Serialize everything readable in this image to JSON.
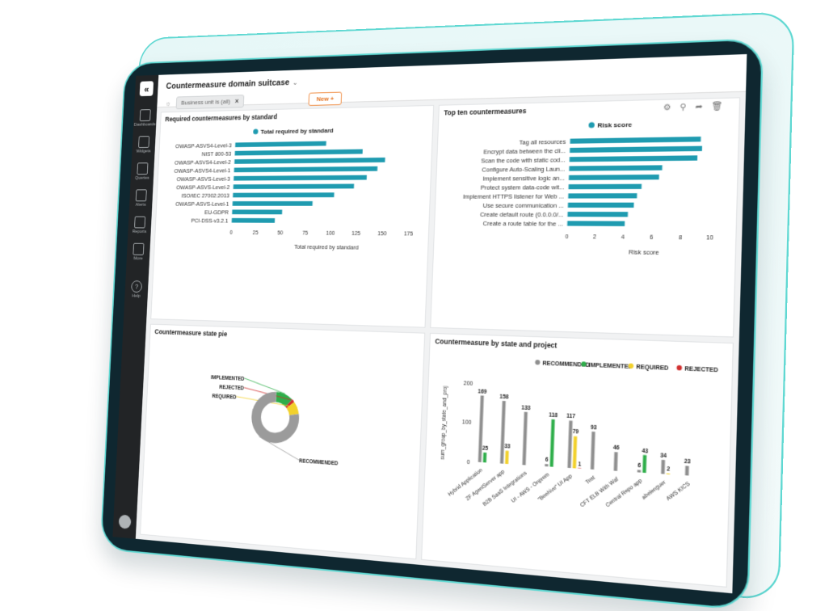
{
  "app": {
    "title": "Countermeasure domain suitcase",
    "filter_chip": "Business unit is (all)",
    "new_button": "New +"
  },
  "sidebar": {
    "items": [
      {
        "label": "Dashboards",
        "icon": "dashboards-icon"
      },
      {
        "label": "Widgets",
        "icon": "widgets-icon"
      },
      {
        "label": "Queries",
        "icon": "queries-icon"
      },
      {
        "label": "Alerts",
        "icon": "alerts-icon"
      },
      {
        "label": "Reports",
        "icon": "reports-icon"
      },
      {
        "label": "More",
        "icon": "more-icon"
      }
    ],
    "help": "Help"
  },
  "panels": {
    "standard": {
      "title": "Required countermeasures by standard"
    },
    "topten": {
      "title": "Top ten countermeasures"
    },
    "state": {
      "title": "Countermeasure state pie"
    },
    "project": {
      "title": "Countermeasure by state and project"
    }
  },
  "chart_data": [
    {
      "type": "bar",
      "orientation": "horizontal",
      "title": "Required countermeasures by standard",
      "categories": [
        "OWASP-ASVS4-Level-3",
        "NIST 800-53",
        "OWASP-ASVS4-Level-2",
        "OWASP-ASVS4-Level-1",
        "OWASP-ASVS-Level-3",
        "OWASP-ASVS-Level-2",
        "ISO/IEC 27002:2013",
        "OWASP-ASVS-Level-1",
        "EU-GDPR",
        "PCI-DSS-v3.2.1"
      ],
      "series": [
        {
          "name": "Total required by standard",
          "values": [
            92,
            128,
            150,
            143,
            133,
            121,
            102,
            81,
            51,
            44
          ]
        }
      ],
      "xlabel": "Total required by standard",
      "xticks": [
        0,
        25,
        50,
        75,
        100,
        125,
        150,
        175
      ],
      "xlim": [
        0,
        175
      ],
      "color": "#1f9bb0"
    },
    {
      "type": "bar",
      "orientation": "horizontal",
      "title": "Top ten countermeasures",
      "categories": [
        "Tag all resources",
        "Encrypt data between the cli...",
        "Scan the code with static cod...",
        "Configure Auto-Scaling Laun...",
        "Implement sensitive logic an...",
        "Protect system data-code wit...",
        "Implement HTTPS listener for Web ...",
        "Use secure communication ...",
        "Create default route (0.0.0.0/...",
        "Create a route table for the ..."
      ],
      "series": [
        {
          "name": "Risk score",
          "values": [
            9.2,
            9.3,
            9.0,
            6.6,
            6.4,
            5.2,
            4.9,
            4.7,
            4.3,
            4.1
          ]
        }
      ],
      "xlabel": "Risk score",
      "xticks": [
        0,
        2,
        4,
        6,
        8,
        10
      ],
      "xlim": [
        0,
        10
      ],
      "color": "#1f9bb0"
    },
    {
      "type": "pie",
      "title": "Countermeasure state pie",
      "labels": [
        "IMPLEMENTED",
        "REJECTED",
        "REQUIRED",
        "RECOMMENDED"
      ],
      "values": [
        12,
        2,
        8,
        78
      ],
      "colors": [
        "#2eae4a",
        "#d12f2f",
        "#f2d12b",
        "#9b9b9b"
      ]
    },
    {
      "type": "bar",
      "title": "Countermeasure by state and project",
      "categories": [
        "Hybrid Application",
        "ZF AgentServer app",
        "B2B SaaS Integrations",
        "UI - AWS - Onprem",
        "\"Beehive\" UI App",
        "Test",
        "CFT ELB With Waf",
        "Central Repo app",
        "abelenguer",
        "AWS KICS"
      ],
      "series": [
        {
          "name": "RECOMMENDED",
          "color": "#8f8f8f",
          "values": [
            169,
            158,
            133,
            6,
            117,
            93,
            46,
            6,
            34,
            23
          ]
        },
        {
          "name": "IMPLEMENTED",
          "color": "#2eae4a",
          "values": [
            25,
            0,
            0,
            118,
            0,
            0,
            0,
            43,
            0,
            0
          ]
        },
        {
          "name": "REQUIRED",
          "color": "#f2d12b",
          "values": [
            0,
            33,
            0,
            0,
            79,
            0,
            0,
            0,
            2,
            0
          ]
        },
        {
          "name": "REJECTED",
          "color": "#d12f2f",
          "values": [
            0,
            0,
            0,
            0,
            1,
            0,
            0,
            0,
            0,
            0
          ]
        }
      ],
      "ylabel": "sum_group_by_state_and_proj",
      "yticks": [
        0,
        100,
        200
      ],
      "ylim": [
        0,
        200
      ],
      "labels_shown": [
        [
          169,
          25
        ],
        [
          158,
          33
        ],
        [
          133
        ],
        [
          6,
          118
        ],
        [
          117,
          79,
          1
        ],
        [
          93
        ],
        [
          46
        ],
        [
          6,
          43
        ],
        [
          34,
          2
        ],
        [
          23
        ]
      ]
    }
  ]
}
